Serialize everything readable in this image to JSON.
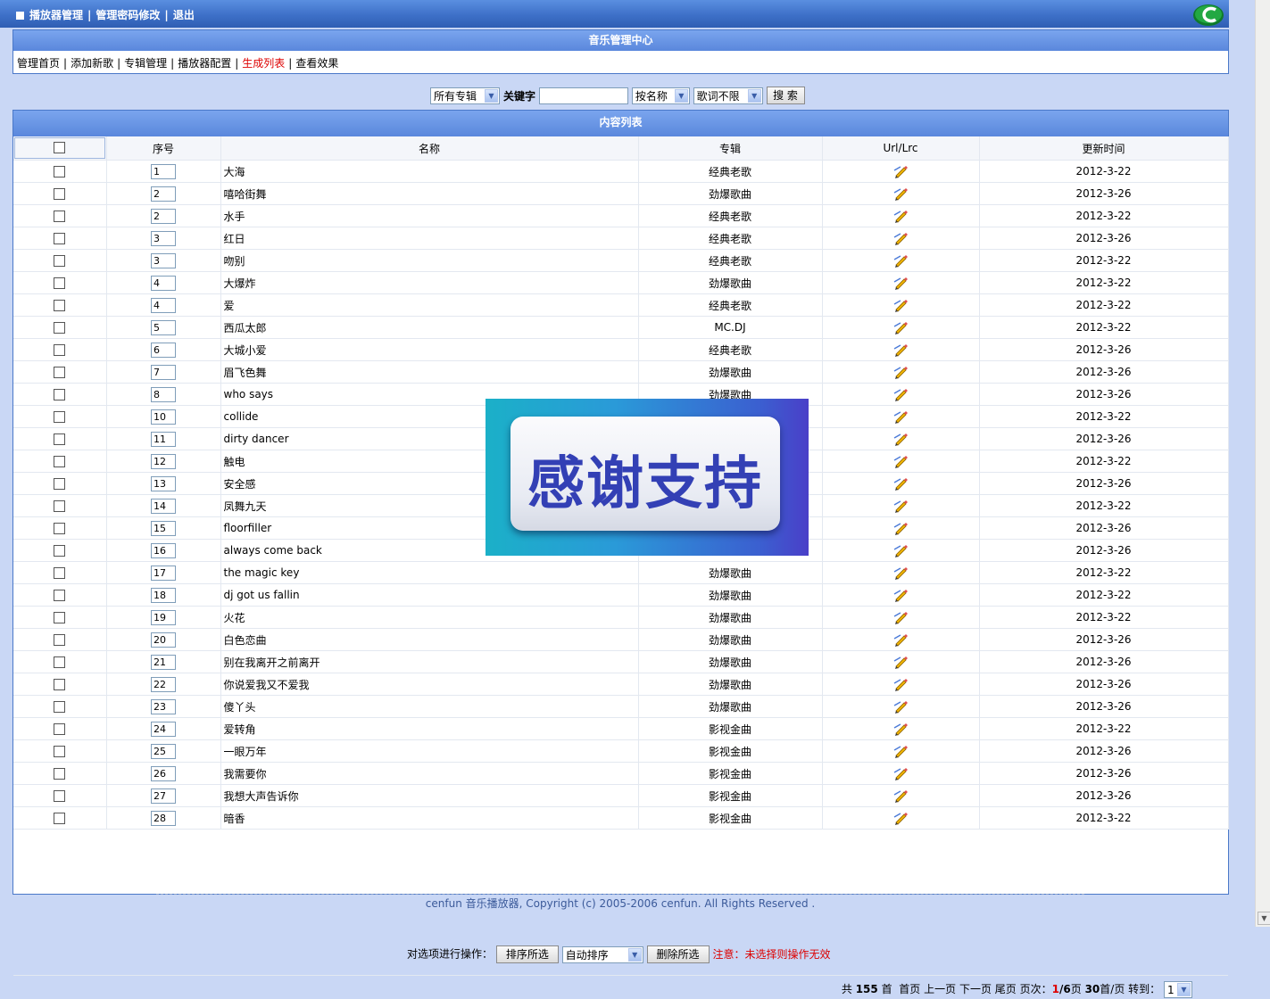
{
  "header": {
    "nav": [
      "播放器管理",
      "管理密码修改",
      "退出"
    ]
  },
  "mgmt_panel": {
    "title": "音乐管理中心",
    "menu": [
      {
        "label": "管理首页",
        "active": false
      },
      {
        "label": "添加新歌",
        "active": false
      },
      {
        "label": "专辑管理",
        "active": false
      },
      {
        "label": "播放器配置",
        "active": false
      },
      {
        "label": "生成列表",
        "active": true
      },
      {
        "label": "查看效果",
        "active": false
      }
    ]
  },
  "search": {
    "album_select": "所有专辑",
    "keyword_label": "关键字",
    "keyword_value": "",
    "field_select": "按名称",
    "lyrics_select": "歌词不限",
    "search_button": "搜 索"
  },
  "content_panel": {
    "title": "内容列表",
    "columns": [
      "序号",
      "名称",
      "专辑",
      "Url/Lrc",
      "更新时间"
    ]
  },
  "rows": [
    {
      "seq": "1",
      "name": "大海",
      "album": "经典老歌",
      "date": "2012-3-22"
    },
    {
      "seq": "2",
      "name": "嘻哈街舞",
      "album": "劲爆歌曲",
      "date": "2012-3-26"
    },
    {
      "seq": "2",
      "name": "水手",
      "album": "经典老歌",
      "date": "2012-3-22"
    },
    {
      "seq": "3",
      "name": "红日",
      "album": "经典老歌",
      "date": "2012-3-26"
    },
    {
      "seq": "3",
      "name": "吻别",
      "album": "经典老歌",
      "date": "2012-3-22"
    },
    {
      "seq": "4",
      "name": "大爆炸",
      "album": "劲爆歌曲",
      "date": "2012-3-22"
    },
    {
      "seq": "4",
      "name": "爱",
      "album": "经典老歌",
      "date": "2012-3-22"
    },
    {
      "seq": "5",
      "name": "西瓜太郎",
      "album": "MC.DJ",
      "date": "2012-3-22"
    },
    {
      "seq": "6",
      "name": "大城小爱",
      "album": "经典老歌",
      "date": "2012-3-26"
    },
    {
      "seq": "7",
      "name": "眉飞色舞",
      "album": "劲爆歌曲",
      "date": "2012-3-26"
    },
    {
      "seq": "8",
      "name": "who says",
      "album": "劲爆歌曲",
      "date": "2012-3-26"
    },
    {
      "seq": "10",
      "name": "collide",
      "album": "",
      "date": "2012-3-22"
    },
    {
      "seq": "11",
      "name": "dirty dancer",
      "album": "",
      "date": "2012-3-26"
    },
    {
      "seq": "12",
      "name": "触电",
      "album": "",
      "date": "2012-3-22"
    },
    {
      "seq": "13",
      "name": "安全感",
      "album": "",
      "date": "2012-3-26"
    },
    {
      "seq": "14",
      "name": "凤舞九天",
      "album": "",
      "date": "2012-3-22"
    },
    {
      "seq": "15",
      "name": "floorfiller",
      "album": "",
      "date": "2012-3-26"
    },
    {
      "seq": "16",
      "name": "always come back",
      "album": "",
      "date": "2012-3-26"
    },
    {
      "seq": "17",
      "name": "the magic key",
      "album": "劲爆歌曲",
      "date": "2012-3-22"
    },
    {
      "seq": "18",
      "name": "dj got us fallin",
      "album": "劲爆歌曲",
      "date": "2012-3-22"
    },
    {
      "seq": "19",
      "name": "火花",
      "album": "劲爆歌曲",
      "date": "2012-3-22"
    },
    {
      "seq": "20",
      "name": "白色恋曲",
      "album": "劲爆歌曲",
      "date": "2012-3-26"
    },
    {
      "seq": "21",
      "name": "别在我离开之前离开",
      "album": "劲爆歌曲",
      "date": "2012-3-26"
    },
    {
      "seq": "22",
      "name": "你说爱我又不爱我",
      "album": "劲爆歌曲",
      "date": "2012-3-26"
    },
    {
      "seq": "23",
      "name": "傻丫头",
      "album": "劲爆歌曲",
      "date": "2012-3-26"
    },
    {
      "seq": "24",
      "name": "爱转角",
      "album": "影视金曲",
      "date": "2012-3-22"
    },
    {
      "seq": "25",
      "name": "一眼万年",
      "album": "影视金曲",
      "date": "2012-3-26"
    },
    {
      "seq": "26",
      "name": "我需要你",
      "album": "影视金曲",
      "date": "2012-3-26"
    },
    {
      "seq": "27",
      "name": "我想大声告诉你",
      "album": "影视金曲",
      "date": "2012-3-26"
    },
    {
      "seq": "28",
      "name": "暗香",
      "album": "影视金曲",
      "date": "2012-3-22"
    }
  ],
  "operations": {
    "label": "对选项进行操作：",
    "sort_button": "排序所选",
    "sort_select": "自动排序",
    "delete_button": "删除所选",
    "warning": "注意：未选择则操作无效"
  },
  "pager": {
    "total_prefix": "共",
    "total": "155",
    "total_suffix": "首",
    "first": "首页",
    "prev": "上一页",
    "next": "下一页",
    "last": "尾页",
    "page_label": "页次：",
    "current_page": "1",
    "page_count": "/6",
    "page_suffix": "页",
    "per_page": "30",
    "per_page_suffix": "首/页",
    "goto_label": "转到：",
    "goto_value": "1"
  },
  "footer": {
    "copyright": "cenfun 音乐播放器, Copyright (c) 2005-2006 cenfun. All Rights Reserved ."
  },
  "banner": {
    "text": "感谢支持"
  },
  "colors": {
    "header": "#3e70c8",
    "panel_title": "#6a96e4",
    "background": "#c9d7f5",
    "active_link": "#dd0000"
  }
}
